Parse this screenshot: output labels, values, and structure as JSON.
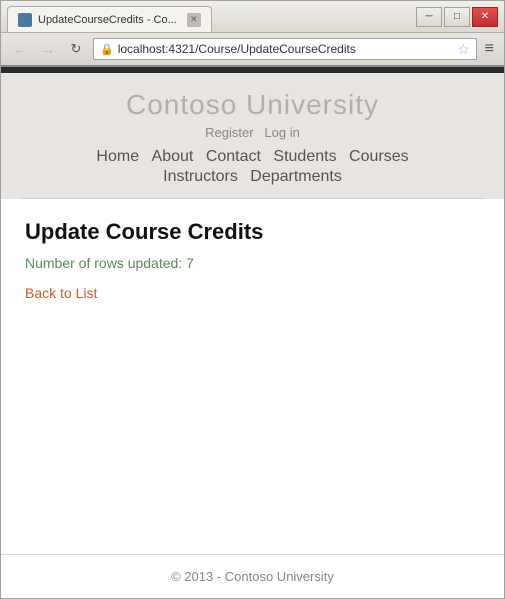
{
  "browser": {
    "tab_title": "UpdateCourseCredits - Co...",
    "url": "localhost:4321/Course/UpdateCourseCredits"
  },
  "site": {
    "title": "Contoso University",
    "auth": {
      "register": "Register",
      "login": "Log in"
    },
    "nav": {
      "home": "Home",
      "about": "About",
      "contact": "Contact",
      "students": "Students",
      "courses": "Courses",
      "instructors": "Instructors",
      "departments": "Departments"
    }
  },
  "page": {
    "heading": "Update Course Credits",
    "status": "Number of rows updated: 7",
    "back_link": "Back to List"
  },
  "footer": {
    "text": "© 2013 - Contoso University"
  },
  "icons": {
    "back_arrow": "←",
    "forward_arrow": "→",
    "refresh": "↻",
    "lock": "🔒",
    "star": "☆",
    "menu": "≡",
    "tab_close": "✕",
    "win_minimize": "─",
    "win_maximize": "□",
    "win_close": "✕"
  }
}
